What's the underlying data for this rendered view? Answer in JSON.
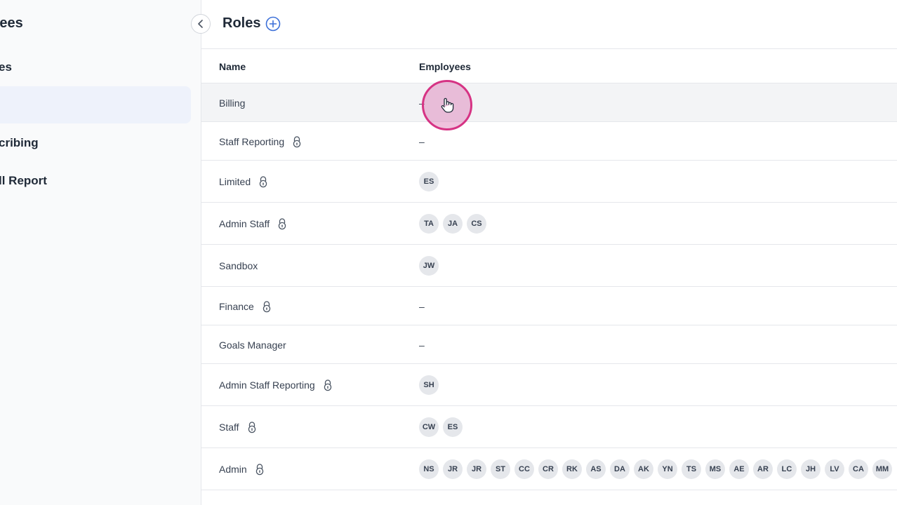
{
  "sidebar": {
    "title": "oyees",
    "items": [
      {
        "label": "es"
      },
      {
        "label": ""
      },
      {
        "label": "cribing"
      },
      {
        "label": "ll Report"
      }
    ]
  },
  "header": {
    "title": "Roles"
  },
  "table": {
    "columns": [
      "Name",
      "Employees"
    ],
    "rows": [
      {
        "name": "Billing",
        "locked": false,
        "employees": [],
        "empty": "–"
      },
      {
        "name": "Staff Reporting",
        "locked": true,
        "employees": [],
        "empty": "–"
      },
      {
        "name": "Limited",
        "locked": true,
        "employees": [
          "ES"
        ]
      },
      {
        "name": "Admin Staff",
        "locked": true,
        "employees": [
          "TA",
          "JA",
          "CS"
        ]
      },
      {
        "name": "Sandbox",
        "locked": false,
        "employees": [
          "JW"
        ]
      },
      {
        "name": "Finance",
        "locked": true,
        "employees": [],
        "empty": "–"
      },
      {
        "name": "Goals Manager",
        "locked": false,
        "employees": [],
        "empty": "–"
      },
      {
        "name": "Admin Staff Reporting",
        "locked": true,
        "employees": [
          "SH"
        ]
      },
      {
        "name": "Staff",
        "locked": true,
        "employees": [
          "CW",
          "ES"
        ]
      },
      {
        "name": "Admin",
        "locked": true,
        "employees": [
          "NS",
          "JR",
          "JR",
          "ST",
          "CC",
          "CR",
          "RK",
          "AS",
          "DA",
          "AK",
          "YN",
          "TS",
          "MS",
          "AE",
          "AR",
          "LC",
          "JH",
          "LV",
          "CA",
          "MM"
        ]
      }
    ]
  },
  "colors": {
    "accent": "#3b6fd8",
    "cursor": "#d63384"
  }
}
